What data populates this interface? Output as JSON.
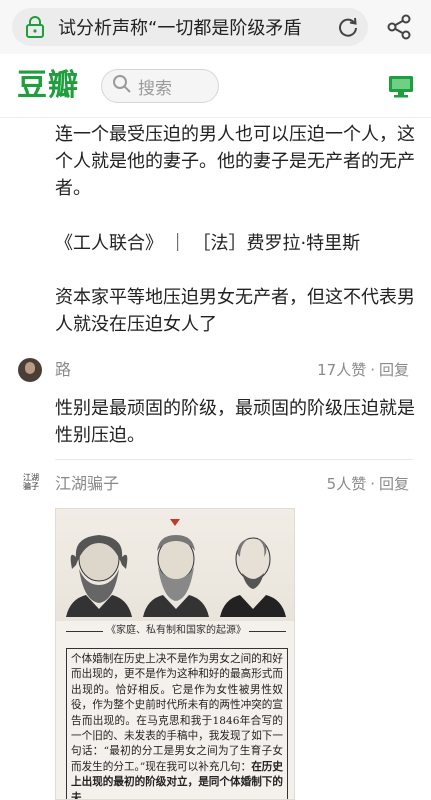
{
  "browser": {
    "url_text": "试分析声称“一切都是阶级矛盾",
    "icons": [
      "lock-icon",
      "reload-icon",
      "share-icon"
    ]
  },
  "site": {
    "logo": "豆瓣",
    "search_placeholder": "搜索",
    "brand_color": "#1e9e3c"
  },
  "post": {
    "paragraph1": "连一个最受压迫的男人也可以压迫一个人，这个人就是他的妻子。他的妻子是无产者的无产者。",
    "citation": "《工人联合》 ｜ ［法］费罗拉·特里斯",
    "paragraph2": "资本家平等地压迫男女无产者，但这不代表男人就没在压迫女人了"
  },
  "comments": [
    {
      "user": "路",
      "likes": "17人赞",
      "reply": "回复",
      "text": "性别是最顽固的阶级，最顽固的阶级压迫就是性别压迫。"
    },
    {
      "user": "江湖骗子",
      "avatar_text": "江湖\n骗子",
      "likes": "5人赞",
      "reply": "回复",
      "image": {
        "caption": "《家庭、私有制和国家的起源》",
        "body_plain": "个体婚制在历史上决不是作为男女之间的和好而出现的，更不是作为这种和好的最高形式而出现的。恰好相反。它是作为女性被男性奴役，作为整个史前时代所未有的两性冲突的宣告而出现的。在马克思和我于1846年合写的一个旧的、未发表的手稿中，我发现了如下一句话：“最初的分工是男女之间为了生育子女而发生的分工。”现在我可以补充几句：",
        "body_bold": "在历史上出现的最初的阶级对立，是同个体婚制下的夫"
      }
    }
  ]
}
